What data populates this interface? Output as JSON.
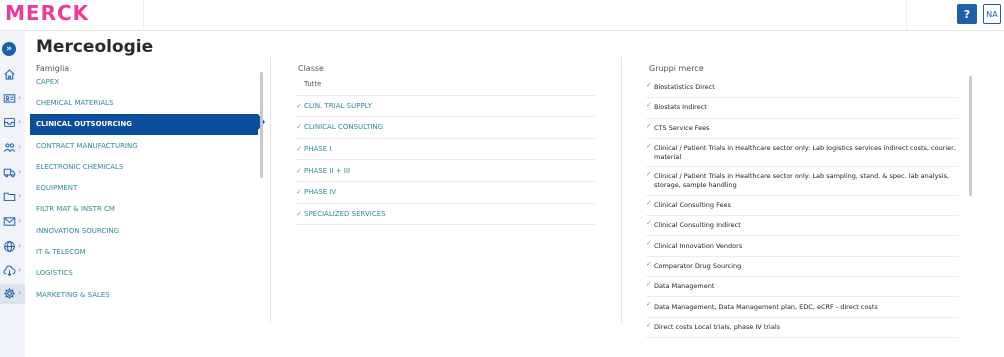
{
  "header": {
    "logo_text": "MERCK",
    "help_label": "?",
    "user_initials": "NA",
    "brand_color": "#eb3c96",
    "accent_color": "#1d5fa8"
  },
  "sidebar": {
    "toggle_label": "»",
    "items": [
      {
        "icon": "home-icon"
      },
      {
        "icon": "id-card-icon"
      },
      {
        "icon": "inbox-icon"
      },
      {
        "icon": "users-icon"
      },
      {
        "icon": "truck-icon"
      },
      {
        "icon": "folder-icon"
      },
      {
        "icon": "mail-icon"
      },
      {
        "icon": "globe-icon"
      },
      {
        "icon": "cloud-download-icon"
      },
      {
        "icon": "gear-icon",
        "active": true
      }
    ]
  },
  "page": {
    "title": "Merceologie"
  },
  "famiglia": {
    "header": "Famiglia",
    "items": [
      "CAPEX",
      "CHEMICAL MATERIALS",
      "CLINICAL OUTSOURCING",
      "CONTRACT MANUFACTURING",
      "ELECTRONIC CHEMICALS",
      "EQUIPMENT",
      "FILTR MAT & INSTR CM",
      "INNOVATION SOURCING",
      "IT & TELECOM",
      "LOGISTICS",
      "MARKETING & SALES"
    ],
    "selected": "CLINICAL OUTSOURCING"
  },
  "classe": {
    "header": "Classe",
    "items": [
      "Tutte",
      "CLIN. TRIAL SUPPLY",
      "CLINICAL CONSULTING",
      "PHASE I",
      "PHASE II + III",
      "PHASE IV",
      "SPECIALIZED SERVICES"
    ]
  },
  "gruppi": {
    "header": "Gruppi merce",
    "items": [
      "Biostatistics Direct",
      "Biostats Indirect",
      "CTS Service Fees",
      "Clinical / Patient Trials in Healthcare sector only: Lab logistics services indirect costs, courier, material",
      "Clinical / Patient Trials in Healthcare sector only: Lab sampling, stand. & spec. lab analysis, storage, sample handling",
      "Clinical Consulting Fees",
      "Clinical Consulting Indirect",
      "Clinical Innovation Vendors",
      "Comparator Drug Sourcing",
      "Data Management",
      "Data Management, Data Management plan, EDC, eCRF - direct costs",
      "Direct costs Local trials, phase IV trials"
    ]
  }
}
